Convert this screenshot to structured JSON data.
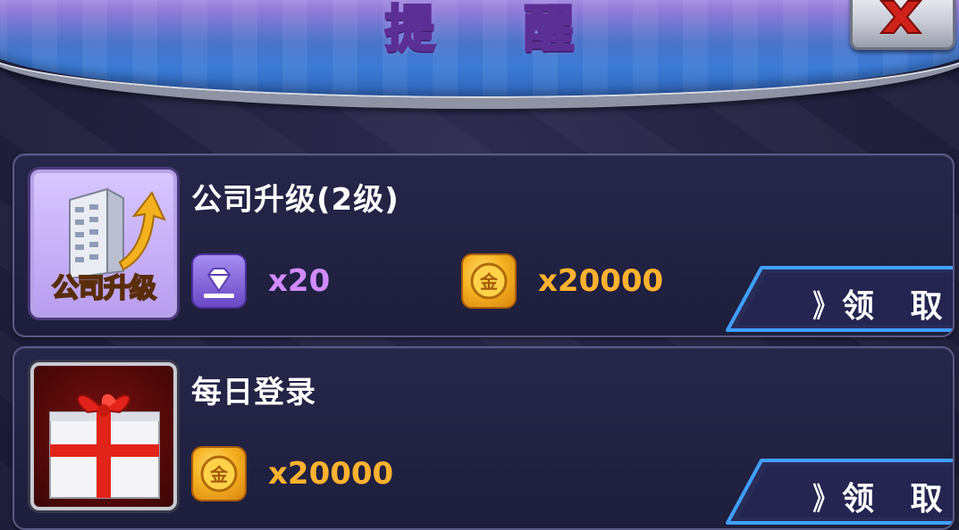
{
  "header": {
    "title": "提 醒"
  },
  "colors": {
    "purple_amount": "#d08cff",
    "gold_amount": "#ffb22e",
    "card_bg": "#23234a",
    "accent_blue": "#3b7bd6"
  },
  "rewards": [
    {
      "title": "公司升级(2级)",
      "thumb_caption": "公司升级",
      "thumb_icon": "company-upgrade-icon",
      "items": [
        {
          "icon": "diamond-icon",
          "amount": "x20"
        },
        {
          "icon": "gold-coin-icon",
          "coin_char": "金",
          "amount": "x20000"
        }
      ],
      "claim_chevron": "》",
      "claim_label": "领 取"
    },
    {
      "title": "每日登录",
      "thumb_icon": "gift-box-icon",
      "items": [
        {
          "icon": "gold-coin-icon",
          "coin_char": "金",
          "amount": "x20000"
        }
      ],
      "claim_chevron": "》",
      "claim_label": "领 取"
    }
  ]
}
